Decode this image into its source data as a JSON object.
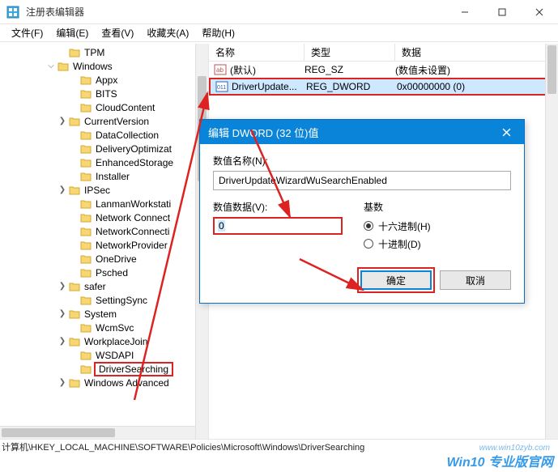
{
  "window": {
    "title": "注册表编辑器",
    "menu": [
      "文件(F)",
      "编辑(E)",
      "查看(V)",
      "收藏夹(A)",
      "帮助(H)"
    ]
  },
  "tree": {
    "items": [
      {
        "indent": 5,
        "exp": "",
        "label": "TPM"
      },
      {
        "indent": 4,
        "exp": "v",
        "label": "Windows"
      },
      {
        "indent": 6,
        "exp": "",
        "label": "Appx"
      },
      {
        "indent": 6,
        "exp": "",
        "label": "BITS"
      },
      {
        "indent": 6,
        "exp": "",
        "label": "CloudContent"
      },
      {
        "indent": 5,
        "exp": ">",
        "label": "CurrentVersion"
      },
      {
        "indent": 6,
        "exp": "",
        "label": "DataCollection"
      },
      {
        "indent": 6,
        "exp": "",
        "label": "DeliveryOptimizat"
      },
      {
        "indent": 6,
        "exp": "",
        "label": "EnhancedStorage"
      },
      {
        "indent": 6,
        "exp": "",
        "label": "Installer"
      },
      {
        "indent": 5,
        "exp": ">",
        "label": "IPSec"
      },
      {
        "indent": 6,
        "exp": "",
        "label": "LanmanWorkstati"
      },
      {
        "indent": 6,
        "exp": "",
        "label": "Network Connect"
      },
      {
        "indent": 6,
        "exp": "",
        "label": "NetworkConnecti"
      },
      {
        "indent": 6,
        "exp": "",
        "label": "NetworkProvider"
      },
      {
        "indent": 6,
        "exp": "",
        "label": "OneDrive"
      },
      {
        "indent": 6,
        "exp": "",
        "label": "Psched"
      },
      {
        "indent": 5,
        "exp": ">",
        "label": "safer"
      },
      {
        "indent": 6,
        "exp": "",
        "label": "SettingSync"
      },
      {
        "indent": 5,
        "exp": ">",
        "label": "System"
      },
      {
        "indent": 6,
        "exp": "",
        "label": "WcmSvc"
      },
      {
        "indent": 5,
        "exp": ">",
        "label": "WorkplaceJoin"
      },
      {
        "indent": 6,
        "exp": "",
        "label": "WSDAPI"
      },
      {
        "indent": 6,
        "exp": "",
        "label": "DriverSearching",
        "selected": true
      },
      {
        "indent": 5,
        "exp": ">",
        "label": "Windows Advanced"
      }
    ]
  },
  "list": {
    "headers": {
      "name": "名称",
      "type": "类型",
      "data": "数据"
    },
    "rows": [
      {
        "icon": "string",
        "name": "(默认)",
        "type": "REG_SZ",
        "data": "(数值未设置)"
      },
      {
        "icon": "dword",
        "name": "DriverUpdate...",
        "type": "REG_DWORD",
        "data": "0x00000000 (0)",
        "selected": true
      }
    ]
  },
  "dialog": {
    "title": "编辑 DWORD (32 位)值",
    "name_label": "数值名称(N):",
    "name_value": "DriverUpdateWizardWuSearchEnabled",
    "value_label": "数值数据(V):",
    "value_value": "0",
    "radix_label": "基数",
    "radix_hex": "十六进制(H)",
    "radix_dec": "十进制(D)",
    "ok": "确定",
    "cancel": "取消"
  },
  "statusbar": "计算机\\HKEY_LOCAL_MACHINE\\SOFTWARE\\Policies\\Microsoft\\Windows\\DriverSearching",
  "watermark": {
    "main": "Win10 专业版官网",
    "sub": "www.win10zyb.com"
  }
}
